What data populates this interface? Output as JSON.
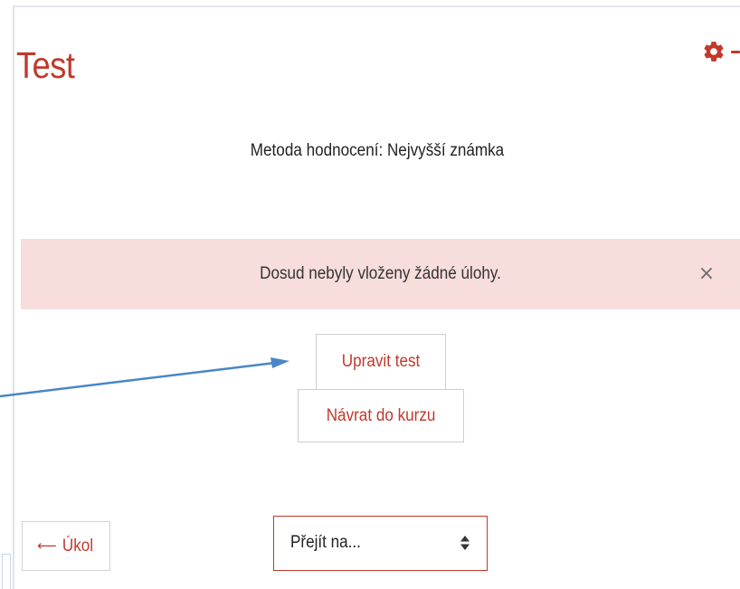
{
  "page": {
    "title": "Test"
  },
  "quiz_info": {
    "grading_method": "Metoda hodnocení: Nejvyšší známka"
  },
  "alert": {
    "message": "Dosud nebyly vloženy žádné úlohy.",
    "close_symbol": "×",
    "background_color": "#f7dddc"
  },
  "actions": {
    "edit_label": "Upravit test",
    "return_label": "Návrat do kurzu"
  },
  "navigation": {
    "prev_arrow": "⟵",
    "prev_label": "Úkol",
    "jump_label": "Přejít na..."
  },
  "theme": {
    "accent": "#c0392b",
    "annotation_arrow": "#4a86c5"
  },
  "icons": {
    "settings": "gear-icon",
    "close": "close-icon",
    "prev": "arrow-left-icon",
    "select": "chevron-updown-icon"
  }
}
